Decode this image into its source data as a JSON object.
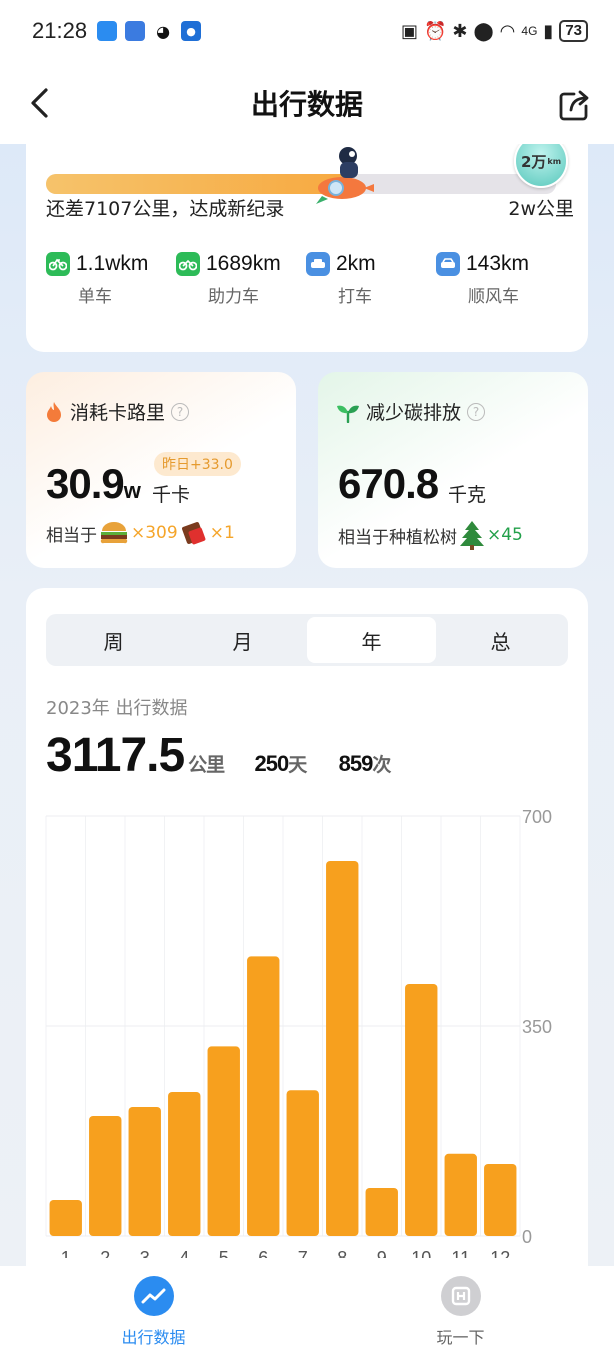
{
  "status": {
    "time": "21:28",
    "battery": "73",
    "network": "4G"
  },
  "header": {
    "title": "出行数据"
  },
  "progress": {
    "fraction": 0.6,
    "remain_text": "还差7107公里，达成新纪录",
    "goal_text": "2w公里",
    "badge_text": "2万",
    "badge_unit": "km"
  },
  "modes": [
    {
      "value": "1.1wkm",
      "label": "单车",
      "color": "#2dbb58",
      "icon": "bike-icon"
    },
    {
      "value": "1689km",
      "label": "助力车",
      "color": "#2dbb58",
      "icon": "ebike-icon"
    },
    {
      "value": "2km",
      "label": "打车",
      "color": "#4a90e2",
      "icon": "taxi-icon"
    },
    {
      "value": "143km",
      "label": "顺风车",
      "color": "#4a90e2",
      "icon": "carpool-icon"
    }
  ],
  "calories": {
    "title": "消耗卡路里",
    "value": "30.9",
    "suffix": "w",
    "unit": "千卡",
    "yesterday": "昨日+33.0",
    "equiv_prefix": "相当于",
    "burger_count": "×309",
    "choc_count": "×1"
  },
  "carbon": {
    "title": "减少碳排放",
    "value": "670.8",
    "unit": "千克",
    "equiv_prefix": "相当于种植松树",
    "tree_count": "×45"
  },
  "tabs": {
    "week": "周",
    "month": "月",
    "year": "年",
    "all": "总",
    "active": "year"
  },
  "year_stats": {
    "label": "2023年 出行数据",
    "distance": "3117.5",
    "distance_unit": "公里",
    "days": "250",
    "days_unit": "天",
    "trips": "859",
    "trips_unit": "次"
  },
  "chart_data": {
    "type": "bar",
    "categories": [
      "1",
      "2",
      "3",
      "4",
      "5",
      "6",
      "7",
      "8",
      "9",
      "10",
      "11",
      "12"
    ],
    "values": [
      60,
      200,
      215,
      240,
      316,
      466,
      243,
      625,
      80,
      420,
      137,
      120
    ],
    "ylim": [
      0,
      700
    ],
    "yticks": [
      "0",
      "350",
      "700"
    ],
    "bar_color": "#f7a01e",
    "grid": true
  },
  "bottom_nav": {
    "travel": "出行数据",
    "play": "玩一下",
    "active_color": "#2b8cf0"
  }
}
